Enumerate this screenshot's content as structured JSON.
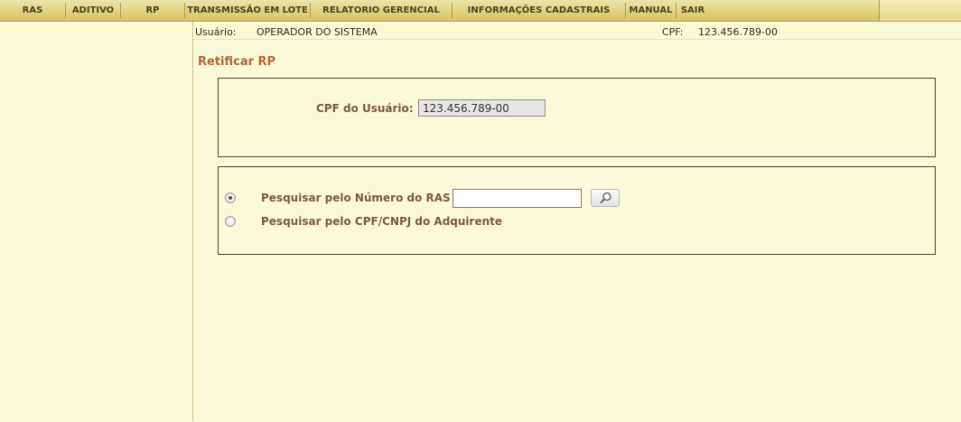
{
  "menu": {
    "items": [
      {
        "label": "RAS"
      },
      {
        "label": "ADITIVO"
      },
      {
        "label": "RP"
      },
      {
        "label": "TRANSMISSÃO EM LOTE"
      },
      {
        "label": "RELATORIO GERENCIAL"
      },
      {
        "label": "INFORMAÇÕES CADASTRAIS"
      },
      {
        "label": "MANUAL"
      },
      {
        "label": "SAIR"
      }
    ]
  },
  "user_info": {
    "user_label": "Usuário:",
    "user_value": "OPERADOR DO SISTEMA",
    "cpf_label": "CPF:",
    "cpf_value": "123.456.789-00"
  },
  "page": {
    "title": "Retificar RP"
  },
  "user_panel": {
    "cpf_label": "CPF do Usuário:",
    "cpf_value": "123.456.789-00"
  },
  "search_panel": {
    "option_ras_label": "Pesquisar pelo Número do RAS",
    "option_ras_selected": true,
    "ras_input_value": "",
    "option_cpf_label": "Pesquisar pelo CPF/CNPJ do Adquirente",
    "option_cpf_selected": false,
    "search_icon": "magnifier-icon"
  },
  "colors": {
    "menu_bar": "#e1d27f",
    "background": "#fbfad8",
    "title": "#b4663a",
    "label": "#7a5a3a"
  }
}
